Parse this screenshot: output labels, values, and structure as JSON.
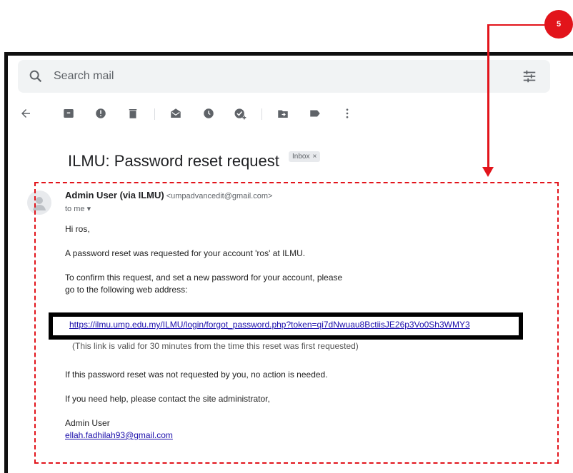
{
  "search": {
    "placeholder": "Search mail"
  },
  "toolbar": {
    "icons": [
      "back-arrow-icon",
      "archive-icon",
      "report-spam-icon",
      "delete-icon",
      "mark-unread-icon",
      "snooze-icon",
      "add-task-icon",
      "move-to-icon",
      "label-icon",
      "more-icon"
    ]
  },
  "email": {
    "subject": "ILMU: Password reset request",
    "label": "Inbox",
    "label_close": "×",
    "sender_name": "Admin User (via ILMU)",
    "sender_email": "<umpadvancedit@gmail.com>",
    "to": "to me",
    "greeting": "Hi ros,",
    "line1": "A password reset was requested for your account 'ros' at ILMU.",
    "line2a": "To confirm this request, and set a new password for your account, please",
    "line2b": "go to the following web address:",
    "reset_link": "https://ilmu.ump.edu.my/ILMU/login/forgot_password.php?token=qi7dNwuau8BctiisJE26p3Vo0Sh3WMY3",
    "validity_note": "(This link is valid for 30 minutes from the time this reset was first requested)",
    "line3": "If this password reset was not requested by you, no action is needed.",
    "line4": "If you need help, please contact the site administrator,",
    "signature_name": "Admin User",
    "signature_email": "ellah.fadhilah93@gmail.com"
  },
  "annotation": {
    "step_number": "5",
    "color": "#e2141b"
  }
}
